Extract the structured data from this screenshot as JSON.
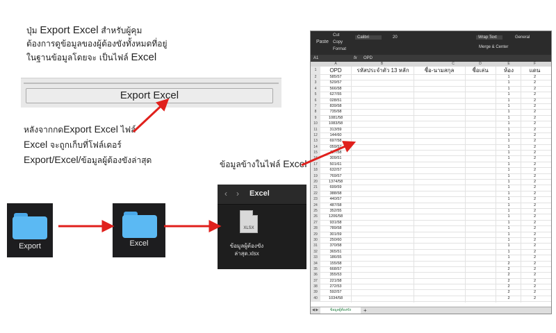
{
  "instruction": {
    "line1_pre": "ปุ่ม ",
    "line1_btn": "Export Excel",
    "line1_post": " สำหรับผู้คุม",
    "line2": "ต้องการดูข้อมูลของผู้ต้องขังทั้งหมดที่อยู่",
    "line3_pre": "ในฐานข้อมูลโดยจะ เป็นไฟล์ ",
    "line3_big": "Excel"
  },
  "export_button": {
    "label": "Export Excel"
  },
  "after_note": {
    "line1_pre": "หลังจากกด",
    "line1_big": "Export Excel",
    "line1_post": " ไฟล์",
    "line2_big": "Excel",
    "line2_post": " จะถูกเก็บที่โฟล์เดอร์",
    "line3_big": "Export/Excel/",
    "line3_post": "ข้อมูลผู้ต้องขังล่าสุด"
  },
  "sheet_note": {
    "text": "ข้อมูลข้างในไฟล์ ",
    "big": "Excel"
  },
  "folders": [
    {
      "label": "Export"
    },
    {
      "label": "Excel"
    }
  ],
  "finder": {
    "title": "Excel",
    "back": "‹",
    "forward": "›",
    "file_ext": "XLSX",
    "file_name": "ข้อมูลผู้ต้องขัง ล่าสุด.xlsx"
  },
  "spreadsheet": {
    "ribbon": {
      "cut": "Cut",
      "copy": "Copy",
      "format": "Format",
      "paste": "Paste",
      "font": "Calibri",
      "size": "20",
      "wrap": "Wrap Text",
      "merge": "Merge & Center",
      "general": "General"
    },
    "name_box": "A1",
    "fx": "fx",
    "formula": "OPD",
    "col_letters": [
      "A",
      "B",
      "C",
      "D",
      "E",
      "F"
    ],
    "headers": [
      "OPD",
      "รหัสประจำตัว 13 หลัก",
      "ชื่อ-นามสกุล",
      "ชื่อเล่น",
      "ห้อง",
      "แดน"
    ],
    "rows": [
      [
        "585/57",
        "1",
        "2"
      ],
      [
        "529/57",
        "1",
        "2"
      ],
      [
        "566/58",
        "1",
        "2"
      ],
      [
        "627/55",
        "1",
        "2"
      ],
      [
        "028/51",
        "1",
        "2"
      ],
      [
        "839/58",
        "1",
        "2"
      ],
      [
        "735/58",
        "1",
        "2"
      ],
      [
        "1081/58",
        "1",
        "2"
      ],
      [
        "1083/58",
        "1",
        "2"
      ],
      [
        "313/59",
        "1",
        "2"
      ],
      [
        "144/60",
        "1",
        "2"
      ],
      [
        "697/58",
        "1",
        "2"
      ],
      [
        "059/57",
        "1",
        "2"
      ],
      [
        "427/58",
        "1",
        "2"
      ],
      [
        "309/51",
        "1",
        "2"
      ],
      [
        "501/61",
        "1",
        "2"
      ],
      [
        "632/57",
        "1",
        "2"
      ],
      [
        "769/57",
        "1",
        "2"
      ],
      [
        "1374/58",
        "1",
        "2"
      ],
      [
        "699/59",
        "1",
        "2"
      ],
      [
        "388/58",
        "1",
        "2"
      ],
      [
        "440/57",
        "1",
        "2"
      ],
      [
        "487/58",
        "1",
        "2"
      ],
      [
        "352/55",
        "1",
        "2"
      ],
      [
        "1206/58",
        "1",
        "2"
      ],
      [
        "931/58",
        "1",
        "2"
      ],
      [
        "789/58",
        "1",
        "2"
      ],
      [
        "301/59",
        "1",
        "2"
      ],
      [
        "250/60",
        "1",
        "2"
      ],
      [
        "370/58",
        "1",
        "2"
      ],
      [
        "365/51",
        "1",
        "2"
      ],
      [
        "186/55",
        "1",
        "2"
      ],
      [
        "155/58",
        "2",
        "2"
      ],
      [
        "668/57",
        "2",
        "2"
      ],
      [
        "355/53",
        "2",
        "2"
      ],
      [
        "221/58",
        "2",
        "2"
      ],
      [
        "272/53",
        "2",
        "2"
      ],
      [
        "592/57",
        "2",
        "2"
      ],
      [
        "1034/58",
        "2",
        "2"
      ]
    ],
    "sheet_tab": "ข้อมูลผู้ต้องขัง",
    "add_tab": "+"
  },
  "colors": {
    "arrow": "#e0201c",
    "folder": "#5bb9f3",
    "dark_tile": "#1d1d1f"
  }
}
